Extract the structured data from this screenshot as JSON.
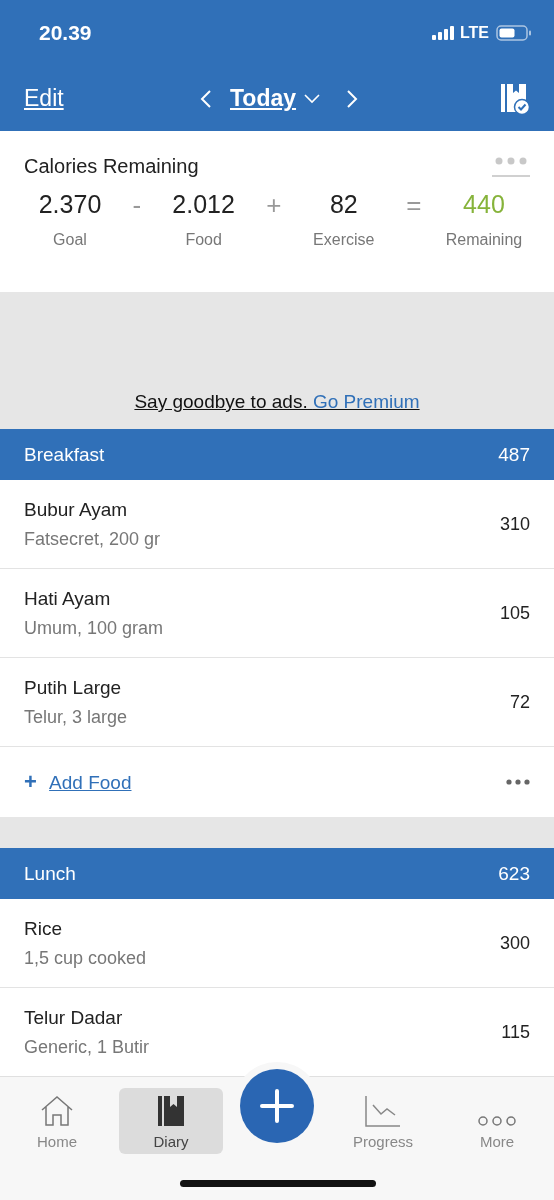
{
  "status_bar": {
    "time": "20.39",
    "network": "LTE"
  },
  "nav": {
    "edit": "Edit",
    "date": "Today"
  },
  "calories": {
    "title": "Calories Remaining",
    "terms": [
      {
        "value": "2.370",
        "label": "Goal",
        "kind": "base",
        "operator": "-"
      },
      {
        "value": "2.012",
        "label": "Food",
        "kind": "base",
        "operator": "+"
      },
      {
        "value": "82",
        "label": "Exercise",
        "kind": "base",
        "operator": "="
      },
      {
        "value": "440",
        "label": "Remaining",
        "kind": "result"
      }
    ]
  },
  "ad": {
    "text": "Say goodbye to ads.",
    "link": "Go Premium"
  },
  "meals": [
    {
      "name": "Breakfast",
      "total": "487",
      "add_icon": "+",
      "add_label": "Add Food",
      "items": [
        {
          "name": "Bubur Ayam",
          "detail": "Fatsecret, 200 gr",
          "calories": "310"
        },
        {
          "name": "Hati Ayam",
          "detail": "Umum, 100 gram",
          "calories": "105"
        },
        {
          "name": "Putih Large",
          "detail": "Telur, 3 large",
          "calories": "72"
        }
      ]
    },
    {
      "name": "Lunch",
      "total": "623",
      "items": [
        {
          "name": "Rice",
          "detail": "1,5 cup cooked",
          "calories": "300"
        },
        {
          "name": "Telur Dadar",
          "detail": "Generic, 1 Butir",
          "calories": "115"
        }
      ]
    }
  ],
  "tab_bar": [
    {
      "label": "Home",
      "kind": "home",
      "selected": false
    },
    {
      "label": "Diary",
      "kind": "diary",
      "selected": true
    },
    {
      "kind": "add"
    },
    {
      "label": "Progress",
      "kind": "progress",
      "selected": false
    },
    {
      "label": "More",
      "kind": "more",
      "selected": false
    }
  ]
}
